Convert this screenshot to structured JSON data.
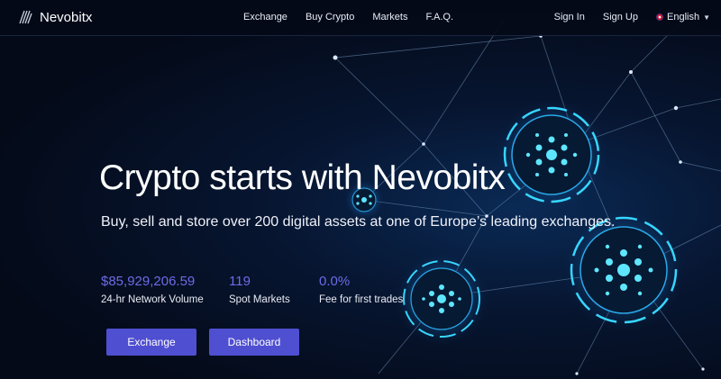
{
  "brand": {
    "name": "Nevobitx"
  },
  "nav": {
    "links": [
      "Exchange",
      "Buy Crypto",
      "Markets",
      "F.A.Q."
    ],
    "sign_in": "Sign In",
    "sign_up": "Sign Up",
    "language": "English"
  },
  "hero": {
    "title": "Crypto starts with Nevobitx",
    "subtitle": "Buy, sell and store over 200 digital assets at one of Europe’s leading exchanges.",
    "stats": [
      {
        "value": "$85,929,206.59",
        "label": "24-hr Network Volume"
      },
      {
        "value": "119",
        "label": "Spot Markets"
      },
      {
        "value": "0.0%",
        "label": "Fee for first trades"
      }
    ],
    "buttons": {
      "exchange": "Exchange",
      "dashboard": "Dashboard"
    }
  },
  "icons": {
    "logo": "stripes-logo-icon",
    "language": "uk-flag-icon",
    "dropdown": "chevron-down-icon"
  },
  "colors": {
    "background": "#050b18",
    "accent": "#4f4fd1",
    "stat_value": "#6d6be6",
    "glow": "#2fd6ff"
  }
}
